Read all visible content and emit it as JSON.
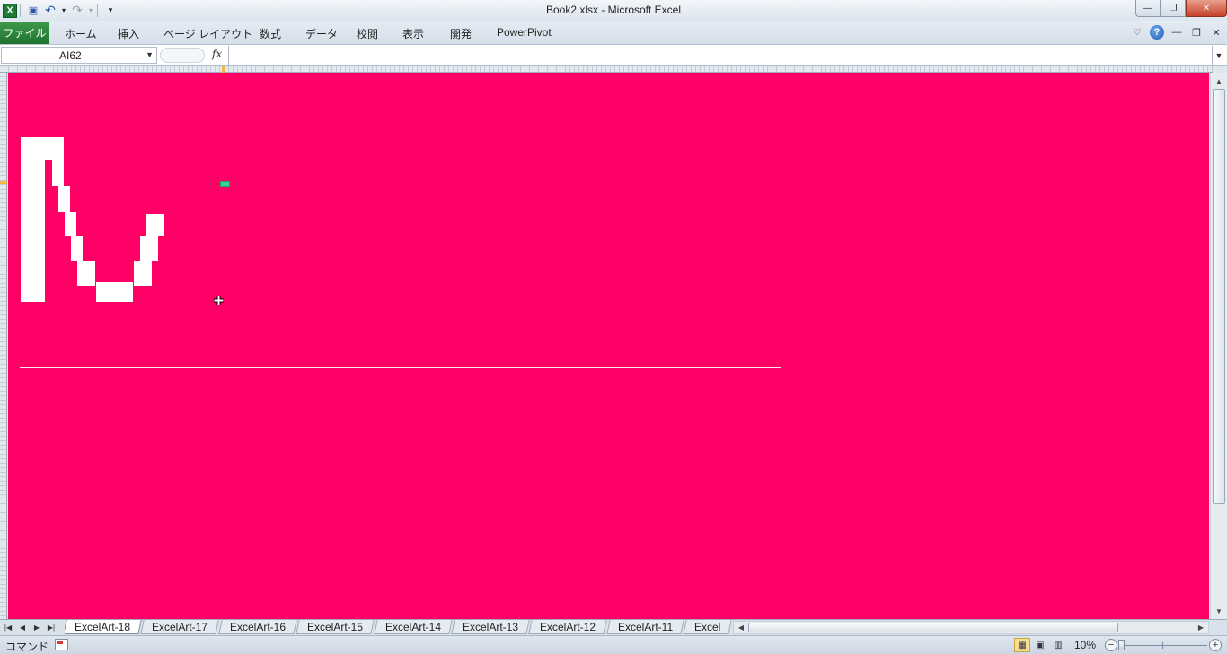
{
  "window": {
    "title": "Book2.xlsx  -  Microsoft Excel",
    "buttons": {
      "minimize": "—",
      "restore": "❐",
      "close": "✕"
    }
  },
  "qat": {
    "logo": "X",
    "save": "💾",
    "undo": "↶",
    "redo": "↷",
    "customize": "▾"
  },
  "ribbon": {
    "file_tab": "ファイル",
    "tabs": [
      "ホーム",
      "挿入",
      "ページ レイアウト",
      "数式",
      "データ",
      "校閲",
      "表示",
      "開発",
      "PowerPivot"
    ],
    "right_icons": {
      "minimize_ribbon": "♡",
      "help": "?",
      "min": "—",
      "restore": "❐",
      "close": "✕"
    }
  },
  "formula_bar": {
    "name_box": "AI62",
    "fx_label": "fx",
    "formula": ""
  },
  "sheet": {
    "background_color": "#ff0066",
    "art_color": "#ffffff",
    "active_cell_color": "#3ad39e"
  },
  "sheet_tabs": {
    "tabs": [
      "ExcelArt-18",
      "ExcelArt-17",
      "ExcelArt-16",
      "ExcelArt-15",
      "ExcelArt-14",
      "ExcelArt-13",
      "ExcelArt-12",
      "ExcelArt-11",
      "Excel"
    ],
    "active_index": 0,
    "nav": [
      "⏮",
      "◀",
      "▶",
      "⏭"
    ]
  },
  "status_bar": {
    "mode": "コマンド",
    "zoom": "10%",
    "zoom_minus": "−",
    "zoom_plus": "+"
  }
}
